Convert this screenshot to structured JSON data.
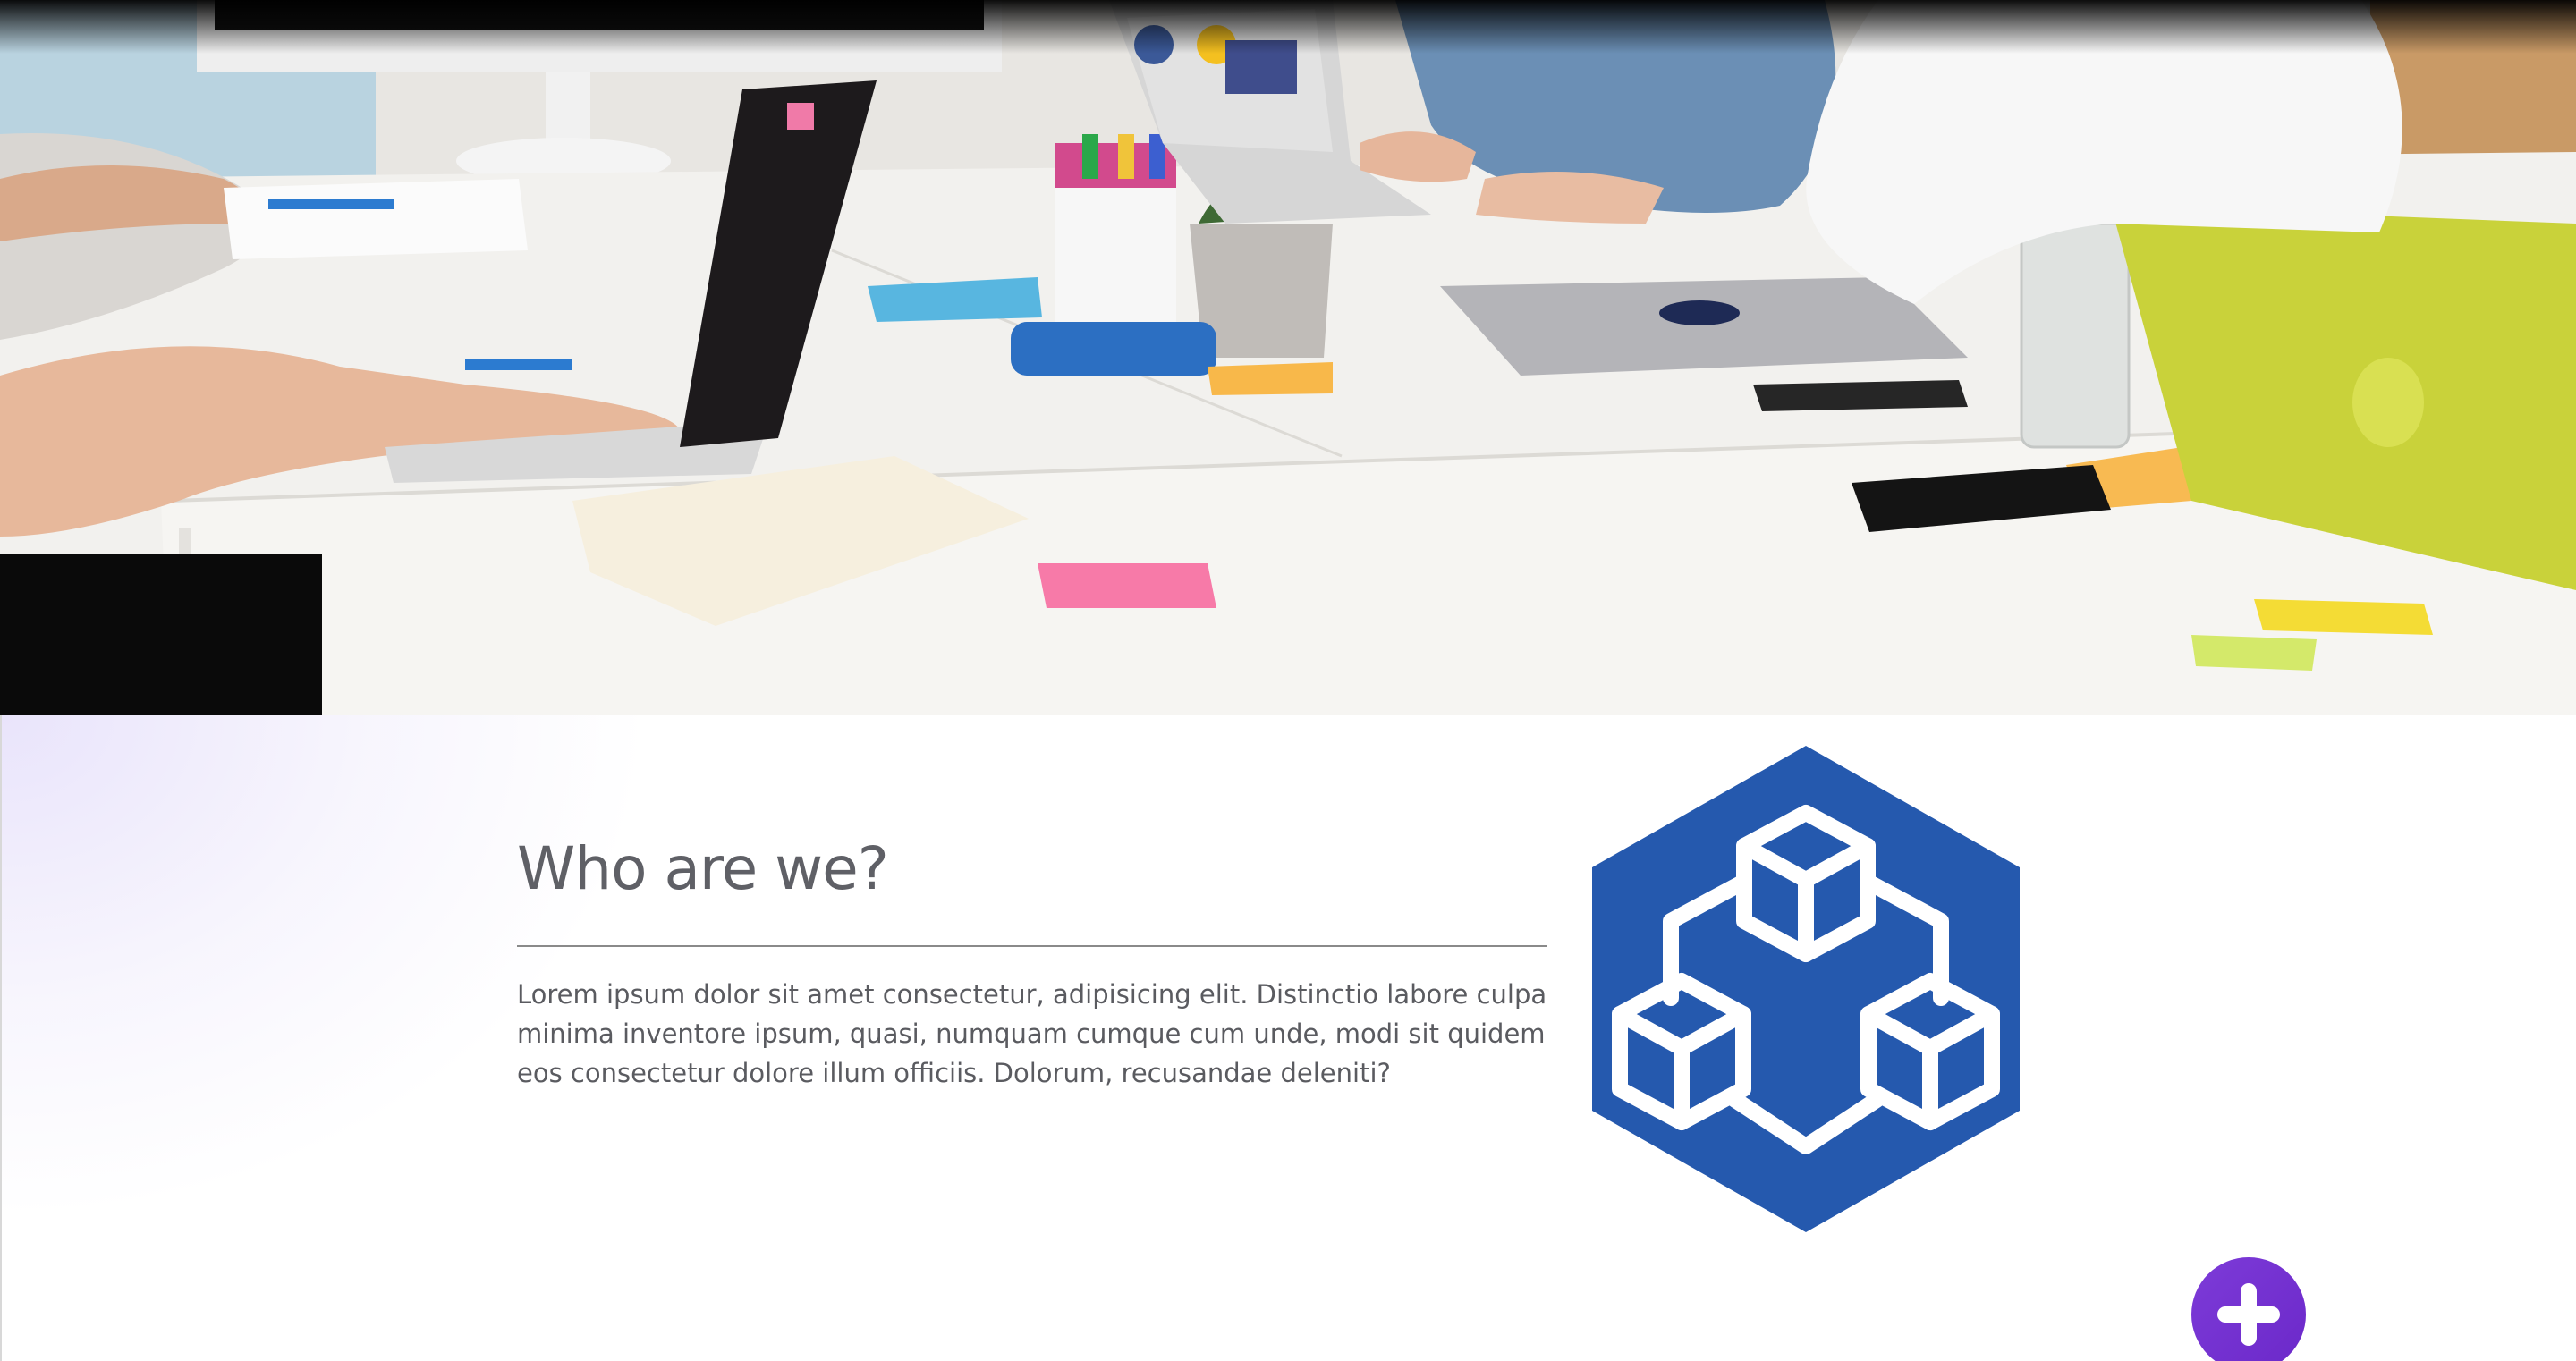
{
  "hero": {
    "image": "team-meeting-photo"
  },
  "about": {
    "title": "Who are we?",
    "text": "Lorem ipsum dolor sit amet consectetur, adipisicing elit. Distinctio labore culpa minima inventore ipsum, quasi, numquam cumque cum unde, modi sit quidem eos consectetur dolore illum officiis. Dolorum, recusandae deleniti?",
    "logo_icon": "hexagon-cubes-icon"
  },
  "fab": {
    "icon": "plus-icon"
  },
  "colors": {
    "heading": "#5f6066",
    "body_text": "#5a5b60",
    "logo_blue": "#2559ae",
    "fab_purple": "#7d3bd8",
    "gradient_lavender": "#e9e4fb"
  }
}
